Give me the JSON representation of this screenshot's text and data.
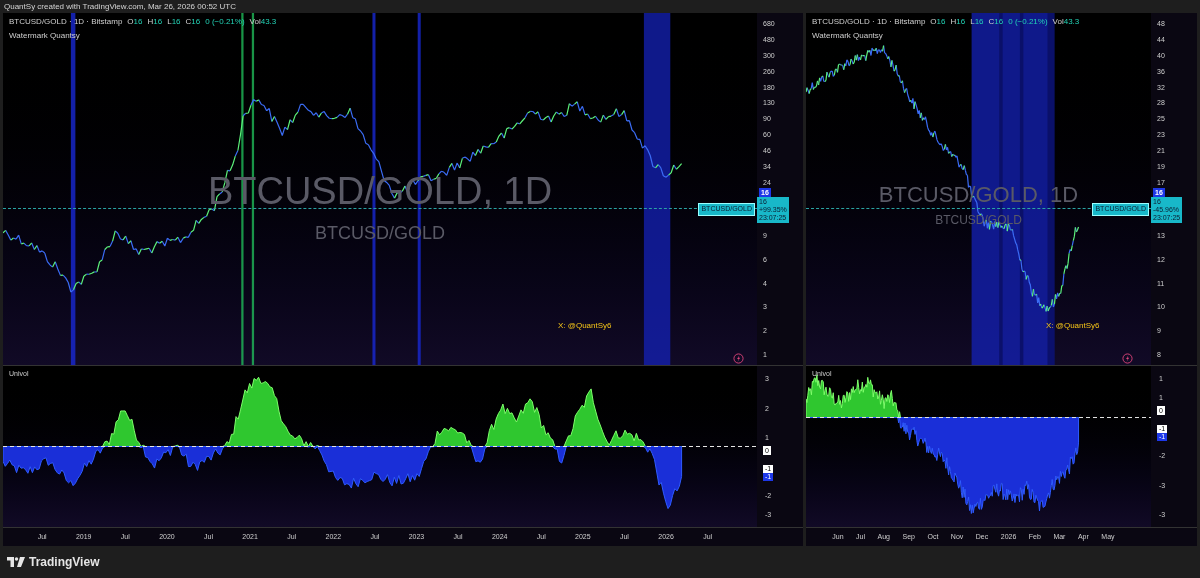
{
  "header": {
    "credit": "QuantSy created with TradingView.com, Mar 26, 2026 00:52 UTC"
  },
  "panels": [
    {
      "legend": {
        "symbol": "BTCUSD/GOLD · 1D · Bitstamp",
        "ohlc": [
          {
            "label": "O",
            "value": "16"
          },
          {
            "label": "H",
            "value": "16"
          },
          {
            "label": "L",
            "value": "16"
          },
          {
            "label": "C",
            "value": "16"
          }
        ],
        "change": "0 (−0.21%)",
        "volume_label": "Vol",
        "volume": "43.3"
      },
      "indicator_name": "Watermark Quantsy",
      "watermark_title": "BTCUSD/GOLD, 1D",
      "watermark_subtitle": "BTCUSD/GOLD",
      "handle": "X: @QuantSy6",
      "price_axis": {
        "upper": [
          "680",
          "480",
          "300",
          "260",
          "180",
          "130",
          "90",
          "60",
          "46",
          "34",
          "24"
        ],
        "lower": [
          "9",
          "6",
          "4",
          "3",
          "2",
          "1"
        ]
      },
      "price_tag": {
        "symbol": "BTCUSD/GOLD",
        "price": "16",
        "value": "16",
        "change": "+99.35%",
        "countdown": "23:07:25"
      },
      "oscillator": {
        "name": "Univol",
        "axis": {
          "upper": [
            "3",
            "2",
            "1"
          ],
          "lower": [
            "-2",
            "-3"
          ]
        },
        "zero_label": "0",
        "value_labels": [
          "-1",
          "-1"
        ]
      },
      "time_axis": [
        "Jul",
        "2019",
        "Jul",
        "2020",
        "Jul",
        "2021",
        "Jul",
        "2022",
        "Jul",
        "2023",
        "Jul",
        "2024",
        "Jul",
        "2025",
        "Jul",
        "2026",
        "Jul"
      ]
    },
    {
      "legend": {
        "symbol": "BTCUSD/GOLD · 1D · Bitstamp",
        "ohlc": [
          {
            "label": "O",
            "value": "16"
          },
          {
            "label": "H",
            "value": "16"
          },
          {
            "label": "L",
            "value": "16"
          },
          {
            "label": "C",
            "value": "16"
          }
        ],
        "change": "0 (−0.21%)",
        "volume_label": "Vol",
        "volume": "43.3"
      },
      "indicator_name": "Watermark Quantsy",
      "watermark_title": "BTCUSD/GOLD, 1D",
      "watermark_subtitle": "BTCUSD/GOLD",
      "handle": "X: @QuantSy6",
      "price_axis": {
        "upper": [
          "48",
          "44",
          "40",
          "36",
          "32",
          "28",
          "25",
          "23",
          "21",
          "19",
          "17"
        ],
        "lower": [
          "13",
          "12",
          "11",
          "10",
          "9",
          "8"
        ]
      },
      "price_tag": {
        "symbol": "BTCUSD/GOLD",
        "price": "16",
        "value": "16",
        "change": "-45.96%",
        "countdown": "23:07:25"
      },
      "oscillator": {
        "name": "Univol",
        "axis": {
          "upper": [
            "1",
            "1"
          ],
          "lower": [
            "-2",
            "-3",
            "-3"
          ]
        },
        "zero_label": "0",
        "value_labels": [
          "-1",
          "-1"
        ]
      },
      "time_axis": [
        "Jun",
        "Jul",
        "Aug",
        "Sep",
        "Oct",
        "Nov",
        "Dec",
        "2026",
        "Feb",
        "Mar",
        "Apr",
        "May"
      ]
    }
  ],
  "footer": {
    "brand": "TradingView"
  }
}
